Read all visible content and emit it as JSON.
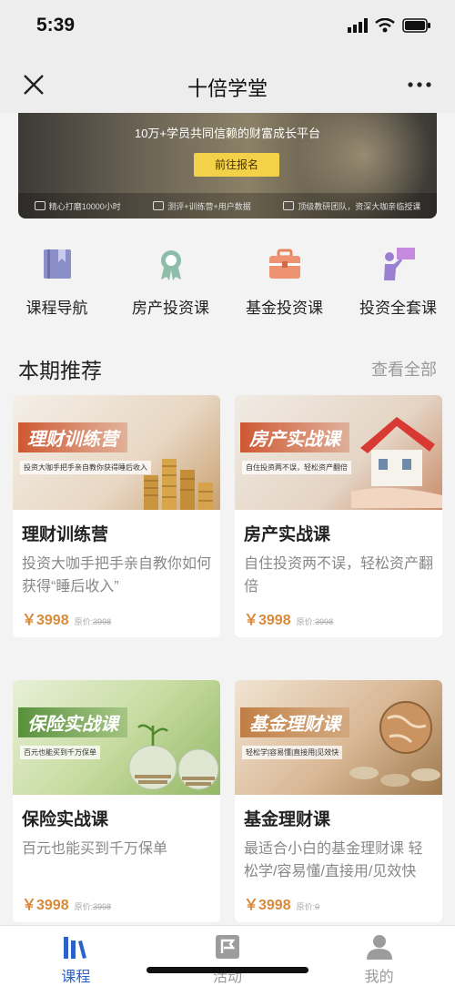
{
  "status_bar": {
    "time": "5:39"
  },
  "nav": {
    "title": "十倍学堂"
  },
  "banner": {
    "tagline": "10万+学员共同信赖的财富成长平台",
    "button": "前往报名",
    "features": [
      "精心打磨10000小时",
      "测评+训练营+用户数据",
      "顶级教研团队，资深大咖亲临授课"
    ]
  },
  "categories": [
    {
      "label": "课程导航",
      "icon": "book-icon"
    },
    {
      "label": "房产投资课",
      "icon": "award-icon"
    },
    {
      "label": "基金投资课",
      "icon": "briefcase-icon"
    },
    {
      "label": "投资全套课",
      "icon": "presenter-icon"
    }
  ],
  "section": {
    "title": "本期推荐",
    "view_all": "查看全部"
  },
  "courses": [
    {
      "image_title": "理财训练营",
      "image_subtitle": "投资大咖手把手亲自教你获得睡后收入",
      "name": "理财训练营",
      "desc": "投资大咖手把手亲自教你如何获得“睡后收入”",
      "price": "￥3998",
      "orig_label": "原价:",
      "orig_price": "3998"
    },
    {
      "image_title": "房产实战课",
      "image_subtitle": "自住投资两不误，轻松资产翻倍",
      "name": "房产实战课",
      "desc": "自住投资两不误，轻松资产翻倍",
      "price": "￥3998",
      "orig_label": "原价:",
      "orig_price": "3998"
    },
    {
      "image_title": "保险实战课",
      "image_subtitle": "百元也能买到千万保单",
      "name": "保险实战课",
      "desc": "百元也能买到千万保单",
      "price": "￥3998",
      "orig_label": "原价:",
      "orig_price": "3998"
    },
    {
      "image_title": "基金理财课",
      "image_subtitle": "轻松学|容易懂|直接用|见效快",
      "name": "基金理财课",
      "desc": "最适合小白的基金理财课 轻松学/容易懂/直接用/见效快",
      "price": "￥3998",
      "orig_label": "原价:",
      "orig_price": "0"
    }
  ],
  "tabs": [
    {
      "label": "课程",
      "icon": "books-icon",
      "active": true
    },
    {
      "label": "活动",
      "icon": "flag-icon",
      "active": false
    },
    {
      "label": "我的",
      "icon": "user-icon",
      "active": false
    }
  ],
  "colors": {
    "price": "#d9893a",
    "tab_active": "#2c62c8",
    "banner_button": "#f3d24a"
  }
}
